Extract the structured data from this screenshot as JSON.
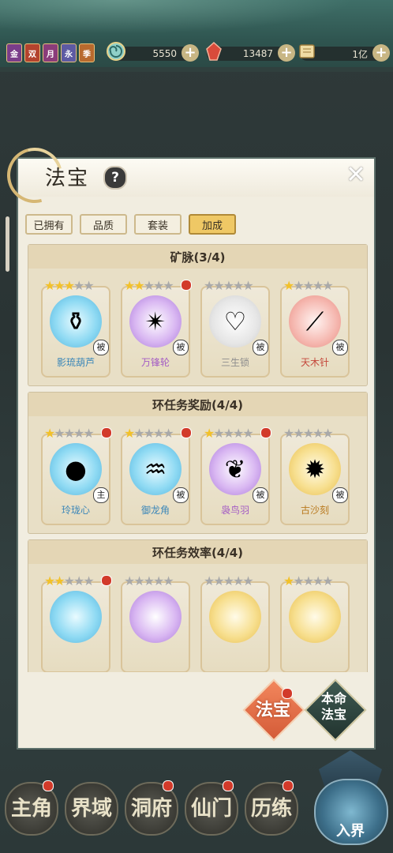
{
  "topbar": {
    "badges": [
      {
        "label": "金",
        "color": "#7a3d8a"
      },
      {
        "label": "双",
        "color": "#b4432e"
      },
      {
        "label": "月",
        "color": "#8a3c7a"
      },
      {
        "label": "永",
        "color": "#5d5aa3"
      },
      {
        "label": "季",
        "color": "#b86a2e"
      }
    ],
    "resources": [
      {
        "icon": "jade-spiral-icon",
        "value": "5550"
      },
      {
        "icon": "red-crystal-icon",
        "value": "13487"
      },
      {
        "icon": "scroll-icon",
        "value": "1亿"
      }
    ]
  },
  "panel": {
    "title": "法宝",
    "help": "?",
    "close": "✕",
    "tabs": [
      {
        "label": "已拥有",
        "active": false
      },
      {
        "label": "品质",
        "active": false
      },
      {
        "label": "套装",
        "active": false
      },
      {
        "label": "加成",
        "active": true
      }
    ],
    "sections": [
      {
        "title": "矿脉(3/4)",
        "items": [
          {
            "name": "影琉葫芦",
            "stars": 3,
            "orb": "blue",
            "glyph": "⚱",
            "tag": "被",
            "dot": false
          },
          {
            "name": "万锋轮",
            "stars": 2,
            "orb": "purple",
            "glyph": "✴",
            "tag": "被",
            "dot": true
          },
          {
            "name": "三生锁",
            "stars": 0,
            "orb": "white",
            "glyph": "♡",
            "tag": "被",
            "dot": false
          },
          {
            "name": "天木针",
            "stars": 1,
            "orb": "red",
            "glyph": "⟋",
            "tag": "被",
            "dot": false
          }
        ]
      },
      {
        "title": "环任务奖励(4/4)",
        "items": [
          {
            "name": "玲珑心",
            "stars": 1,
            "orb": "blue",
            "glyph": "●",
            "tag": "主",
            "dot": true
          },
          {
            "name": "御龙角",
            "stars": 1,
            "orb": "blue",
            "glyph": "♒",
            "tag": "被",
            "dot": true
          },
          {
            "name": "袅鸟羽",
            "stars": 1,
            "orb": "purple",
            "glyph": "❦",
            "tag": "被",
            "dot": true
          },
          {
            "name": "古沙刻",
            "stars": 0,
            "orb": "gold",
            "glyph": "✹",
            "tag": "被",
            "dot": false
          }
        ]
      },
      {
        "title": "环任务效率(4/4)",
        "items": [
          {
            "name": "",
            "stars": 2,
            "orb": "blue",
            "glyph": "",
            "tag": "",
            "dot": true
          },
          {
            "name": "",
            "stars": 0,
            "orb": "purple",
            "glyph": "",
            "tag": "",
            "dot": false
          },
          {
            "name": "",
            "stars": 0,
            "orb": "gold",
            "glyph": "",
            "tag": "",
            "dot": false
          },
          {
            "name": "",
            "stars": 1,
            "orb": "gold",
            "glyph": "",
            "tag": "",
            "dot": false
          }
        ]
      }
    ],
    "fabao_button": "法宝",
    "benming_button_line1": "本命",
    "benming_button_line2": "法宝"
  },
  "bottom_nav": [
    {
      "label": "主角",
      "dot": true
    },
    {
      "label": "界域",
      "dot": false
    },
    {
      "label": "洞府",
      "dot": true
    },
    {
      "label": "仙门",
      "dot": true
    },
    {
      "label": "历练",
      "dot": true
    },
    {
      "label": "入界",
      "dot": false
    }
  ]
}
